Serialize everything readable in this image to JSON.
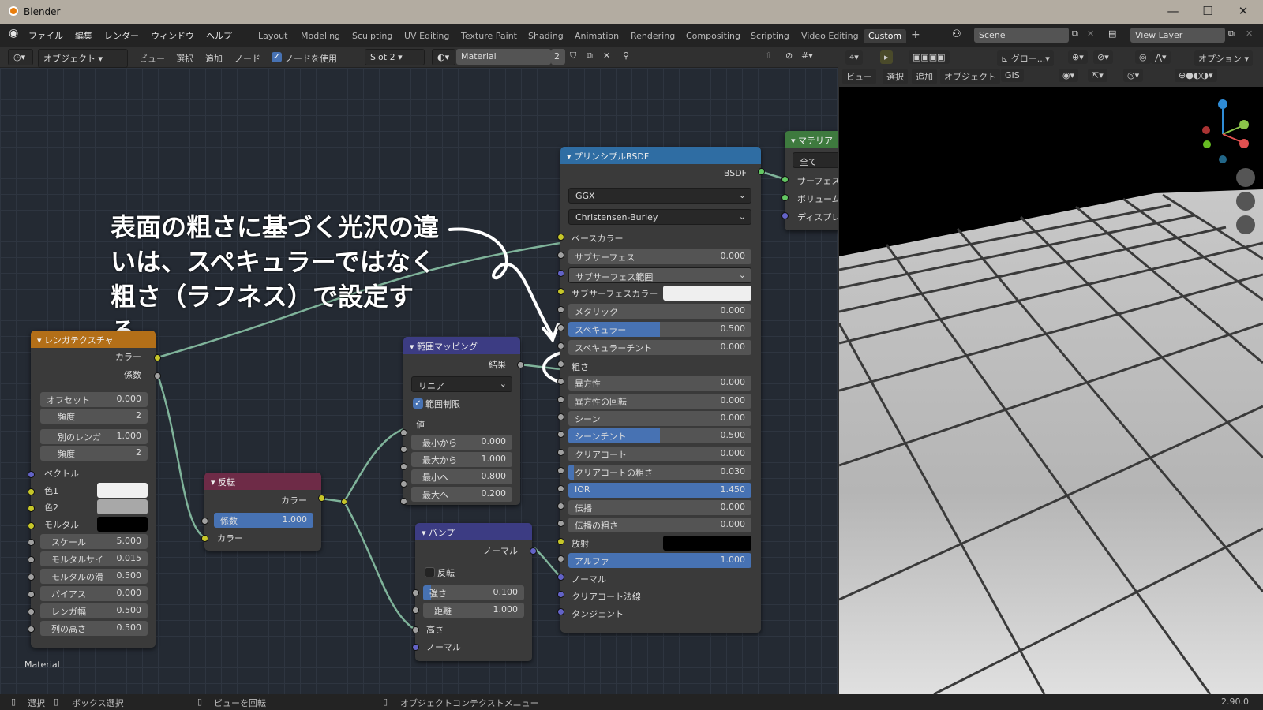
{
  "window": {
    "title": "Blender",
    "minimize": "—",
    "maximize": "☐",
    "close": "✕"
  },
  "menus": [
    "ファイル",
    "編集",
    "レンダー",
    "ウィンドウ",
    "ヘルプ"
  ],
  "workspaces": [
    "Layout",
    "Modeling",
    "Sculpting",
    "UV Editing",
    "Texture Paint",
    "Shading",
    "Animation",
    "Rendering",
    "Compositing",
    "Scripting",
    "Video Editing",
    "Custom"
  ],
  "active_workspace": "Custom",
  "scene": "Scene",
  "view_layer": "View Layer",
  "node_header": {
    "mode": "オブジェクト",
    "view": "ビュー",
    "select": "選択",
    "add": "追加",
    "node": "ノード",
    "use_nodes": "ノードを使用",
    "slot": "Slot 2",
    "material": "Material",
    "users": "2"
  },
  "viewport_header": {
    "global": "グロー...",
    "options": "オプション",
    "view": "ビュー",
    "select": "選択",
    "add": "追加",
    "object": "オブジェクト",
    "gis": "GIS"
  },
  "annotation": "表面の粗さに基づく光沢の違いは、スペキュラーではなく粗さ（ラフネス）で設定する。",
  "editor_label": "Material",
  "nodes": {
    "brick": {
      "title": "レンガテクスチャ",
      "out_color": "カラー",
      "out_fac": "係数",
      "offset_label": "オフセット",
      "offset": "0.000",
      "freq_label": "頻度",
      "freq1": "2",
      "squash_label": "別のレンガ",
      "squash": "1.000",
      "freq2": "2",
      "vector": "ベクトル",
      "color1": "色1",
      "color2": "色2",
      "mortar": "モルタル",
      "scale_label": "スケール",
      "scale": "5.000",
      "mortar_size_label": "モルタルサイ",
      "mortar_size": "0.015",
      "mortar_smooth_label": "モルタルの滑",
      "mortar_smooth": "0.500",
      "bias_label": "バイアス",
      "bias": "0.000",
      "brick_width_label": "レンガ幅",
      "brick_width": "0.500",
      "row_height_label": "列の高さ",
      "row_height": "0.500",
      "color1_hex": "#f0f0f0",
      "color2_hex": "#a8a8a8",
      "mortar_hex": "#000000"
    },
    "invert": {
      "title": "反転",
      "out_color": "カラー",
      "fac_label": "係数",
      "fac": "1.000",
      "in_color": "カラー"
    },
    "map_range": {
      "title": "範囲マッピング",
      "out_result": "結果",
      "interp": "リニア",
      "clamp": "範囲制限",
      "value": "値",
      "from_min_label": "最小から",
      "from_min": "0.000",
      "from_max_label": "最大から",
      "from_max": "1.000",
      "to_min_label": "最小へ",
      "to_min": "0.800",
      "to_max_label": "最大へ",
      "to_max": "0.200"
    },
    "bump": {
      "title": "バンプ",
      "out_normal": "ノーマル",
      "invert": "反転",
      "strength_label": "強さ",
      "strength": "0.100",
      "distance_label": "距離",
      "distance": "1.000",
      "height": "高さ",
      "normal": "ノーマル"
    },
    "bsdf": {
      "title": "プリンシプルBSDF",
      "out": "BSDF",
      "distribution": "GGX",
      "subsurface_method": "Christensen-Burley",
      "base_color": "ベースカラー",
      "subsurface_label": "サブサーフェス",
      "subsurface": "0.000",
      "subsurface_radius": "サブサーフェス範囲",
      "subsurface_color": "サブサーフェスカラー",
      "metallic_label": "メタリック",
      "metallic": "0.000",
      "specular_label": "スペキュラー",
      "specular": "0.500",
      "specular_tint_label": "スペキュラーチント",
      "specular_tint": "0.000",
      "roughness": "粗さ",
      "anisotropic_label": "異方性",
      "anisotropic": "0.000",
      "aniso_rot_label": "異方性の回転",
      "aniso_rot": "0.000",
      "sheen_label": "シーン",
      "sheen": "0.000",
      "sheen_tint_label": "シーンチント",
      "sheen_tint": "0.500",
      "clearcoat_label": "クリアコート",
      "clearcoat": "0.000",
      "clearcoat_rough_label": "クリアコートの粗さ",
      "clearcoat_rough": "0.030",
      "ior_label": "IOR",
      "ior": "1.450",
      "transmission_label": "伝播",
      "transmission": "0.000",
      "transmission_rough_label": "伝播の粗さ",
      "transmission_rough": "0.000",
      "emission": "放射",
      "alpha_label": "アルファ",
      "alpha": "1.000",
      "normal": "ノーマル",
      "clearcoat_normal": "クリアコート法線",
      "tangent": "タンジェント"
    },
    "output": {
      "title": "マテリア",
      "target": "全て",
      "surface": "サーフェス",
      "volume": "ボリューム",
      "displacement": "ディスプレ"
    }
  },
  "status": {
    "select": "選択",
    "box_select": "ボックス選択",
    "rotate_view": "ビューを回転",
    "context_menu": "オブジェクトコンテクストメニュー",
    "version": "2.90.0"
  },
  "colors": {
    "accent": "#4772b3",
    "color_socket": "#c7c729",
    "float_socket": "#a1a1a1",
    "vector_socket": "#6363c7",
    "shader_socket": "#63c763"
  }
}
